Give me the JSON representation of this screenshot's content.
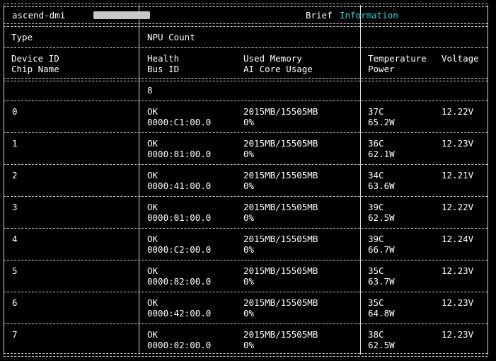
{
  "header": {
    "tool": "ascend-dmi",
    "title_word1": "Brief",
    "title_word2": "Information"
  },
  "columns": {
    "type": "Type",
    "npu_count": "NPU Count",
    "device_id": "Device ID",
    "chip_name": "Chip Name",
    "health": "Health",
    "bus_id": "Bus ID",
    "used_memory": "Used Memory",
    "ai_core_usage": "AI Core Usage",
    "temperature": "Temperature",
    "power": "Power",
    "voltage": "Voltage"
  },
  "npu_count_value": "8",
  "devices": [
    {
      "id": "0",
      "health": "OK",
      "bus_id": "0000:C1:00.0",
      "memory": "2015MB/15505MB",
      "ai_core": "0%",
      "temp": "37C",
      "power": "65.2W",
      "voltage": "12.22V"
    },
    {
      "id": "1",
      "health": "OK",
      "bus_id": "0000:81:00.0",
      "memory": "2015MB/15505MB",
      "ai_core": "0%",
      "temp": "36C",
      "power": "62.1W",
      "voltage": "12.23V"
    },
    {
      "id": "2",
      "health": "OK",
      "bus_id": "0000:41:00.0",
      "memory": "2015MB/15505MB",
      "ai_core": "0%",
      "temp": "34C",
      "power": "63.6W",
      "voltage": "12.21V"
    },
    {
      "id": "3",
      "health": "OK",
      "bus_id": "0000:01:00.0",
      "memory": "2015MB/15505MB",
      "ai_core": "0%",
      "temp": "39C",
      "power": "62.5W",
      "voltage": "12.22V"
    },
    {
      "id": "4",
      "health": "OK",
      "bus_id": "0000:C2:00.0",
      "memory": "2015MB/15505MB",
      "ai_core": "0%",
      "temp": "39C",
      "power": "66.7W",
      "voltage": "12.24V"
    },
    {
      "id": "5",
      "health": "OK",
      "bus_id": "0000:82:00.0",
      "memory": "2015MB/15505MB",
      "ai_core": "0%",
      "temp": "35C",
      "power": "63.7W",
      "voltage": "12.23V"
    },
    {
      "id": "6",
      "health": "OK",
      "bus_id": "0000:42:00.0",
      "memory": "2015MB/15505MB",
      "ai_core": "0%",
      "temp": "35C",
      "power": "64.8W",
      "voltage": "12.23V"
    },
    {
      "id": "7",
      "health": "OK",
      "bus_id": "0000:02:00.0",
      "memory": "2015MB/15505MB",
      "ai_core": "0%",
      "temp": "38C",
      "power": "62.5W",
      "voltage": "12.23V"
    }
  ]
}
